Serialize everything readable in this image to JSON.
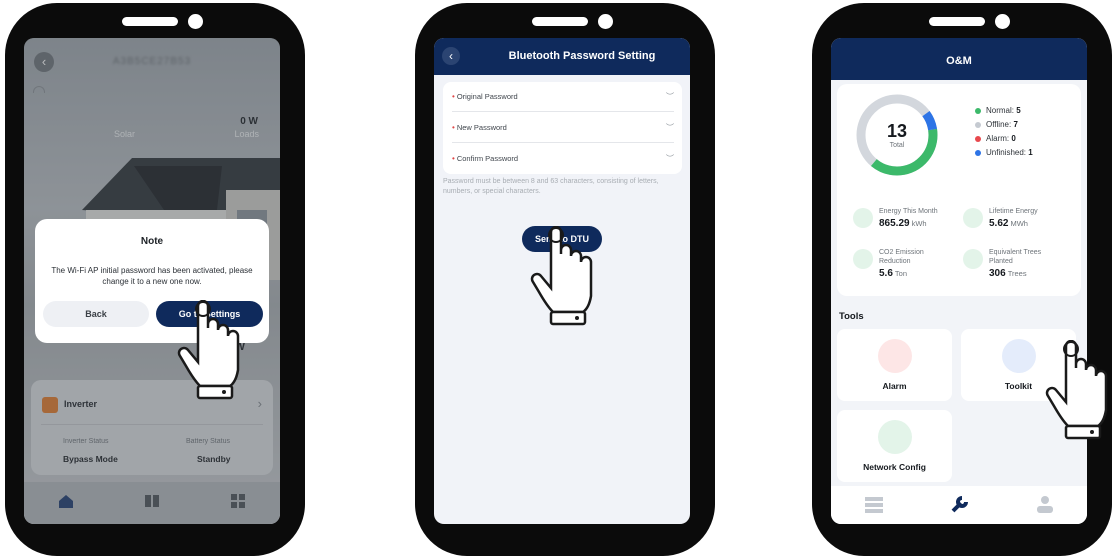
{
  "phone1": {
    "header_title": "A3B5CE27B53",
    "solar_label": "Solar",
    "loads_value": "0 W",
    "loads_label": "Loads",
    "modal": {
      "title": "Note",
      "message": "The Wi-Fi AP initial password has been activated, please change it to a new one now.",
      "back_label": "Back",
      "go_label": "Go to Settings"
    },
    "power_value": "W",
    "inverter": {
      "name": "Inverter",
      "inverter_status_label": "Inverter Status",
      "inverter_status_value": "Bypass Mode",
      "battery_status_label": "Battery Status",
      "battery_status_value": "Standby"
    },
    "nav_icons": [
      "home-icon",
      "device-icon",
      "grid-icon"
    ]
  },
  "phone2": {
    "title": "Bluetooth Password Setting",
    "fields": [
      {
        "label": "Original Password"
      },
      {
        "label": "New Password"
      },
      {
        "label": "Confirm Password"
      }
    ],
    "hint": "Password must be between 8 and 63 characters, consisting of letters, numbers, or special characters.",
    "send_label": "Send to DTU"
  },
  "phone3": {
    "title": "O&M",
    "total_value": "13",
    "total_label": "Total",
    "legend": [
      {
        "label": "Normal:",
        "value": "5",
        "color": "#3cb96a"
      },
      {
        "label": "Offline:",
        "value": "7",
        "color": "#c5cad1"
      },
      {
        "label": "Alarm:",
        "value": "0",
        "color": "#e8484d"
      },
      {
        "label": "Unfinished:",
        "value": "1",
        "color": "#2d74e6"
      }
    ],
    "metrics": [
      {
        "label": "Energy This Month",
        "value": "865.29",
        "unit": "kWh"
      },
      {
        "label": "Lifetime Energy",
        "value": "5.62",
        "unit": "MWh"
      },
      {
        "label": "CO2 Emission Reduction",
        "value": "5.6",
        "unit": "Ton"
      },
      {
        "label": "Equivalent Trees Planted",
        "value": "306",
        "unit": "Trees"
      }
    ],
    "tools_title": "Tools",
    "tools": [
      {
        "label": "Alarm"
      },
      {
        "label": "Toolkit"
      },
      {
        "label": "Network Config"
      }
    ]
  }
}
